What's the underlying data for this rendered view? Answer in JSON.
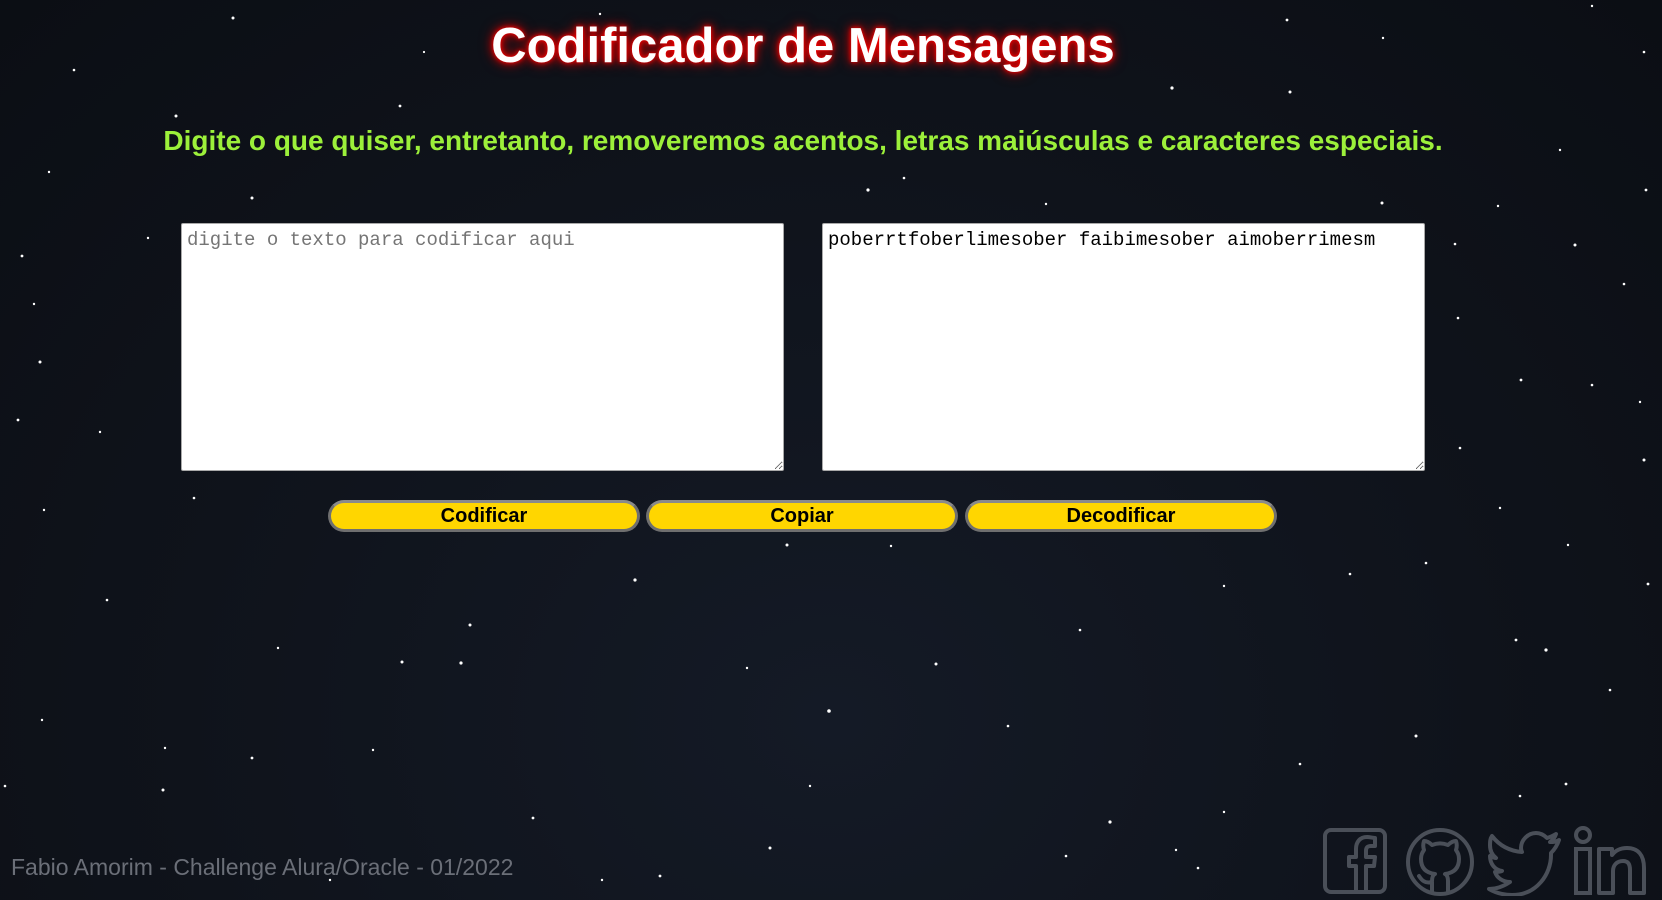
{
  "page": {
    "title": "Codificador de Mensagens",
    "subtitle": "Digite o que quiser, entretanto, removeremos acentos, letras maiúsculas e caracteres especiais."
  },
  "input": {
    "placeholder": "digite o texto para codificar aqui",
    "value": ""
  },
  "output": {
    "value": "poberrtfoberlimesober faibimesober aimoberrimesm"
  },
  "buttons": {
    "encode": "Codificar",
    "copy": "Copiar",
    "decode": "Decodificar"
  },
  "footer": {
    "credit": "Fabio Amorim - Challenge Alura/Oracle - 01/2022"
  },
  "social": [
    {
      "name": "facebook-icon"
    },
    {
      "name": "github-icon"
    },
    {
      "name": "twitter-icon"
    },
    {
      "name": "linkedin-icon"
    }
  ],
  "colors": {
    "background": "#0f131b",
    "title_glow": "#ff0000",
    "subtitle": "#9cf03a",
    "button": "#ffd600",
    "footer_text": "#6b6f78",
    "social_icons": "#4a4f58"
  }
}
